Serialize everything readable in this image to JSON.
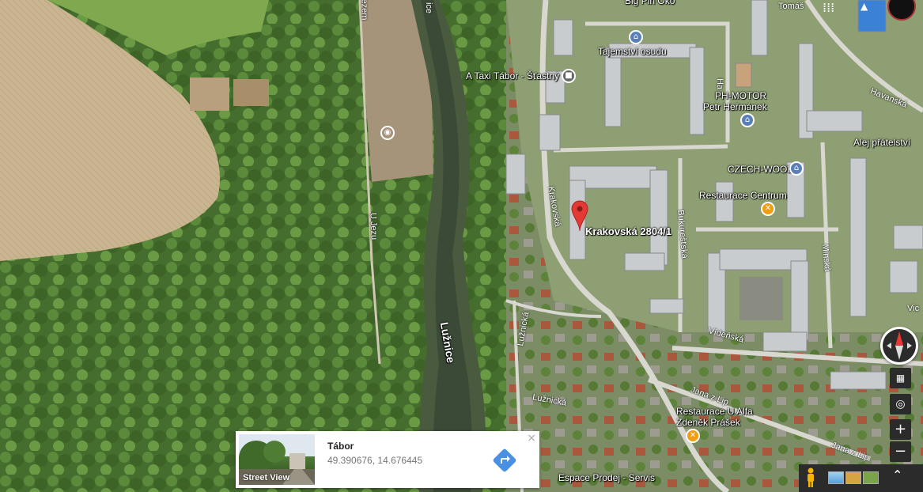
{
  "map": {
    "place_labels": [
      {
        "name": "big-pin-oko",
        "text": "Big Pin Oko"
      },
      {
        "name": "tajemstvi-osudu",
        "text": "Tajemství osudu"
      },
      {
        "name": "a-taxi-tabor",
        "text": "A Taxi Tábor - Šťastný"
      },
      {
        "name": "ph-motor",
        "text": "PH-MOTOR"
      },
      {
        "name": "petr-hermanek",
        "text": "Petr Heřmánek"
      },
      {
        "name": "czech-wool",
        "text": "CZECH-WOOL"
      },
      {
        "name": "restaurace-centrum",
        "text": "Restaurace Centrum"
      },
      {
        "name": "restaurace-u-alfa",
        "text": "Restaurace U Alfa"
      },
      {
        "name": "zdenek-prasek",
        "text": "Zdeněk Prášek"
      },
      {
        "name": "espace-prodej",
        "text": "Espace Prodej - Servis"
      },
      {
        "name": "alej-pratelstvi",
        "text": "Alej přátelství"
      }
    ],
    "street_labels": {
      "krakovska": "Krakovská",
      "bukurestska": "Bukurešťská",
      "minska": "Minská",
      "videnska": "Vídeňská",
      "havanska": "Havanská",
      "luznicka_street": "Lužnická",
      "luznicka_lower": "Lužnická",
      "jana_z_lipe": "Jana z Lip",
      "jana_z_lipe_2": "Jana z Lip",
      "u_jezu": "U Jezu",
      "luznice": "Lužnice",
      "havanska_2": "Ha",
      "tomas": "Tomáš",
      "vic": "Vic",
      "ice": "ice",
      "ezem": "ezem"
    },
    "marker": {
      "label": "Krakovská 2804/1",
      "color": "#e53935"
    }
  },
  "card": {
    "title": "Tábor",
    "coords": "49.390676, 14.676445",
    "streetview_label": "Street View",
    "close_symbol": "×",
    "directions_icon": "directions-arrow-icon",
    "accent": "#4a90e2"
  },
  "controls": {
    "zoom_in": "+",
    "zoom_out": "−",
    "expand": "⌃"
  }
}
